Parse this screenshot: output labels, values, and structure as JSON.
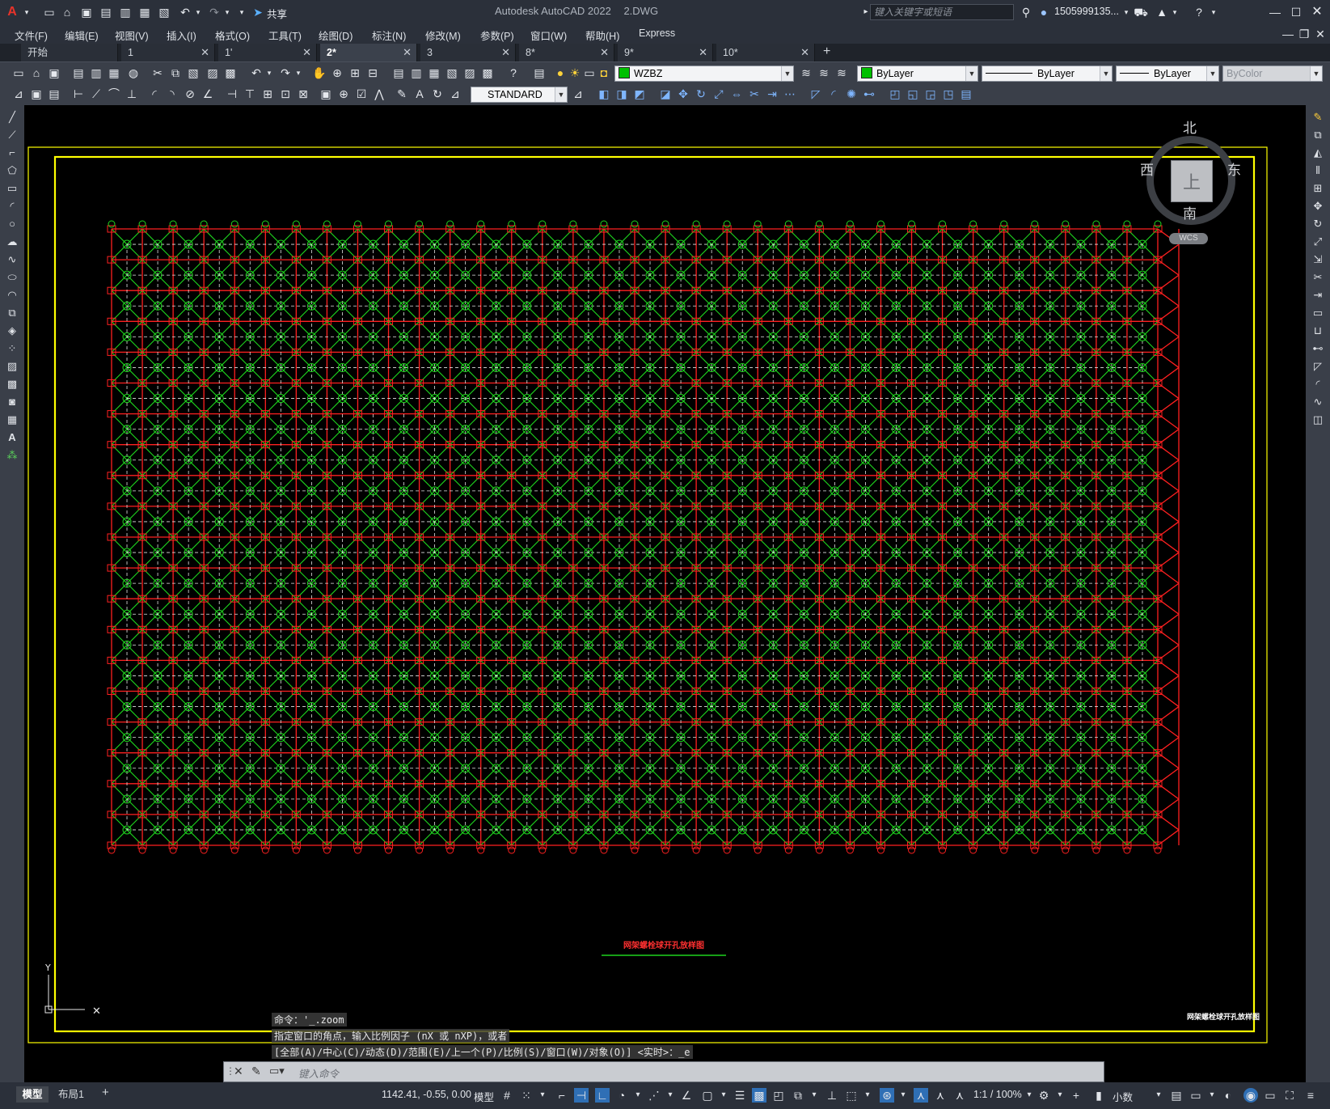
{
  "app": {
    "title": "Autodesk AutoCAD 2022",
    "filename": "2.DWG",
    "share_label": "共享",
    "search_placeholder": "键入关键字或短语",
    "user": "1505999135...",
    "window_controls": [
      "minimize-icon",
      "maximize-icon",
      "close-icon"
    ]
  },
  "menu": [
    "文件(F)",
    "编辑(E)",
    "视图(V)",
    "插入(I)",
    "格式(O)",
    "工具(T)",
    "绘图(D)",
    "标注(N)",
    "修改(M)",
    "参数(P)",
    "窗口(W)",
    "帮助(H)",
    "Express"
  ],
  "tabs": [
    {
      "label": "开始",
      "active": false,
      "closable": false
    },
    {
      "label": "1",
      "active": false,
      "closable": true
    },
    {
      "label": "1'",
      "active": false,
      "closable": true
    },
    {
      "label": "2*",
      "active": true,
      "closable": true
    },
    {
      "label": "3",
      "active": false,
      "closable": true
    },
    {
      "label": "8*",
      "active": false,
      "closable": true
    },
    {
      "label": "9*",
      "active": false,
      "closable": true
    },
    {
      "label": "10*",
      "active": false,
      "closable": true
    }
  ],
  "tab_add": "+",
  "toolbar": {
    "layer": "WZBZ",
    "layer_color": "#00c000",
    "color": "ByLayer",
    "linetype": "ByLayer",
    "lineweight": "ByLayer",
    "plotstyle": "ByColor",
    "textstyle": "STANDARD"
  },
  "viewcube": {
    "north": "北",
    "south": "南",
    "east": "东",
    "west": "西",
    "face": "上",
    "wcs": "WCS"
  },
  "drawing": {
    "title_text": "网架螺栓球开孔放样图",
    "corner_text": "网架螺栓球开孔放样图",
    "grid_cols": 34,
    "grid_rows": 20,
    "colors": {
      "frame": "#ffff00",
      "member": "#ff2020",
      "node": "#1ed31e",
      "dash": "#e6e6e6"
    }
  },
  "command": {
    "history": [
      "命令：'_.zoom",
      "指定窗口的角点，输入比例因子 (nX 或 nXP)，或者",
      "[全部(A)/中心(C)/动态(D)/范围(E)/上一个(P)/比例(S)/窗口(W)/对象(O)] <实时>：_e"
    ],
    "placeholder": "键入命令"
  },
  "layout_tabs": [
    "模型",
    "布局1"
  ],
  "layout_add": "+",
  "status": {
    "coords": "1142.41, -0.55, 0.00",
    "model": "模型",
    "scale": "1:1 / 100%",
    "units": "小数"
  }
}
